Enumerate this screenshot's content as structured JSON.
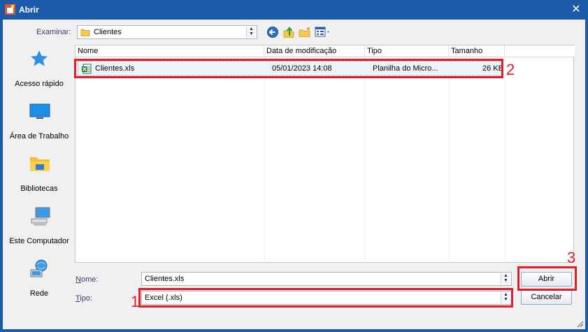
{
  "window": {
    "title": "Abrir",
    "close_glyph": "✕"
  },
  "toolbar": {
    "look_in_label": "Examinar:",
    "look_in_value": "Clientes",
    "icons": [
      "back-icon",
      "up-folder-icon",
      "new-folder-icon",
      "view-menu-icon"
    ]
  },
  "places": [
    {
      "label": "Acesso rápido",
      "icon": "star-icon"
    },
    {
      "label": "Área de Trabalho",
      "icon": "desktop-icon"
    },
    {
      "label": "Bibliotecas",
      "icon": "libraries-icon"
    },
    {
      "label": "Este Computador",
      "icon": "computer-icon"
    },
    {
      "label": "Rede",
      "icon": "network-icon"
    }
  ],
  "filelist": {
    "columns": [
      "Nome",
      "Data de modificação",
      "Tipo",
      "Tamanho"
    ],
    "rows": [
      {
        "name": "Clientes.xls",
        "modified": "05/01/2023 14:08",
        "type": "Planilha do Micro...",
        "size": "26 KB"
      }
    ]
  },
  "bottom": {
    "name_label_u": "N",
    "name_label_rest": "ome:",
    "name_value": "Clientes.xls",
    "type_label_u": "T",
    "type_label_rest": "ipo:",
    "type_value": "Excel (.xls)",
    "open_button": "Abrir",
    "cancel_button": "Cancelar"
  },
  "annotations": {
    "n1": "1",
    "n2": "2",
    "n3": "3",
    "color": "#e11d2a"
  },
  "colors": {
    "titlebar": "#1b5aa8",
    "dialog_bg": "#f0f0f0",
    "label_text": "#3a3a7a"
  }
}
